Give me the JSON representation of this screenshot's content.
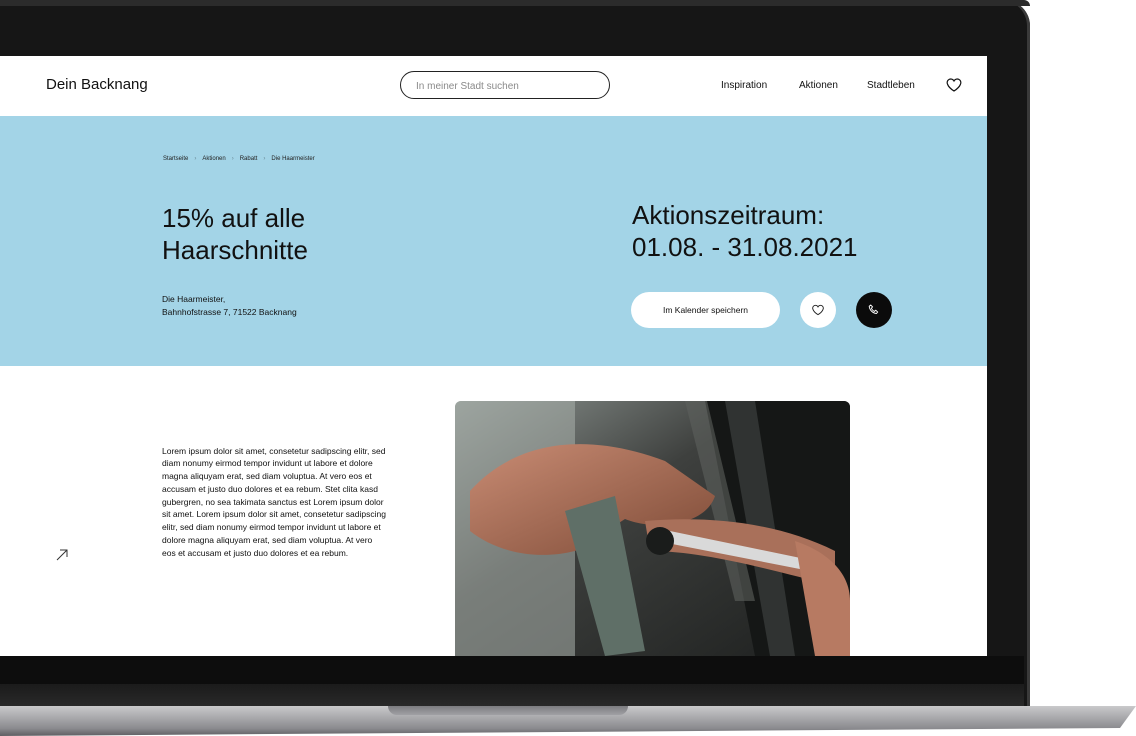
{
  "header": {
    "logo": "Dein Backnang",
    "search_placeholder": "In meiner Stadt suchen",
    "nav": [
      "Inspiration",
      "Aktionen",
      "Stadtleben"
    ]
  },
  "hero": {
    "breadcrumb": [
      "Startseite",
      "Aktionen",
      "Rabatt",
      "Die Haarmeister"
    ],
    "title_line1": "15% auf alle",
    "title_line2": "Haarschnitte",
    "address_line1": "Die Haarmeister,",
    "address_line2": "Bahnhofstrasse 7, 71522 Backnang",
    "period_line1": "Aktionszeitraum:",
    "period_line2": "01.08. - 31.08.2021",
    "calendar_button": "Im Kalender speichern"
  },
  "content": {
    "body_text": "Lorem ipsum dolor sit amet, consetetur sadipscing elitr, sed diam nonumy eirmod tempor invidunt ut labore et dolore magna aliquyam erat, sed diam voluptua. At vero eos et accusam et justo duo dolores et ea rebum. Stet clita kasd gubergren, no sea takimata sanctus est Lorem ipsum dolor sit amet. Lorem ipsum dolor sit amet, consetetur sadipscing elitr, sed diam nonumy eirmod tempor invidunt ut labore et dolore magna aliquyam erat, sed diam voluptua. At vero eos et accusam et justo duo dolores et ea rebum."
  },
  "colors": {
    "hero_bg": "#a3d4e7",
    "call_button": "#0b0b0b"
  },
  "icons": [
    "heart-icon",
    "phone-icon",
    "arrow-up-right-icon"
  ]
}
